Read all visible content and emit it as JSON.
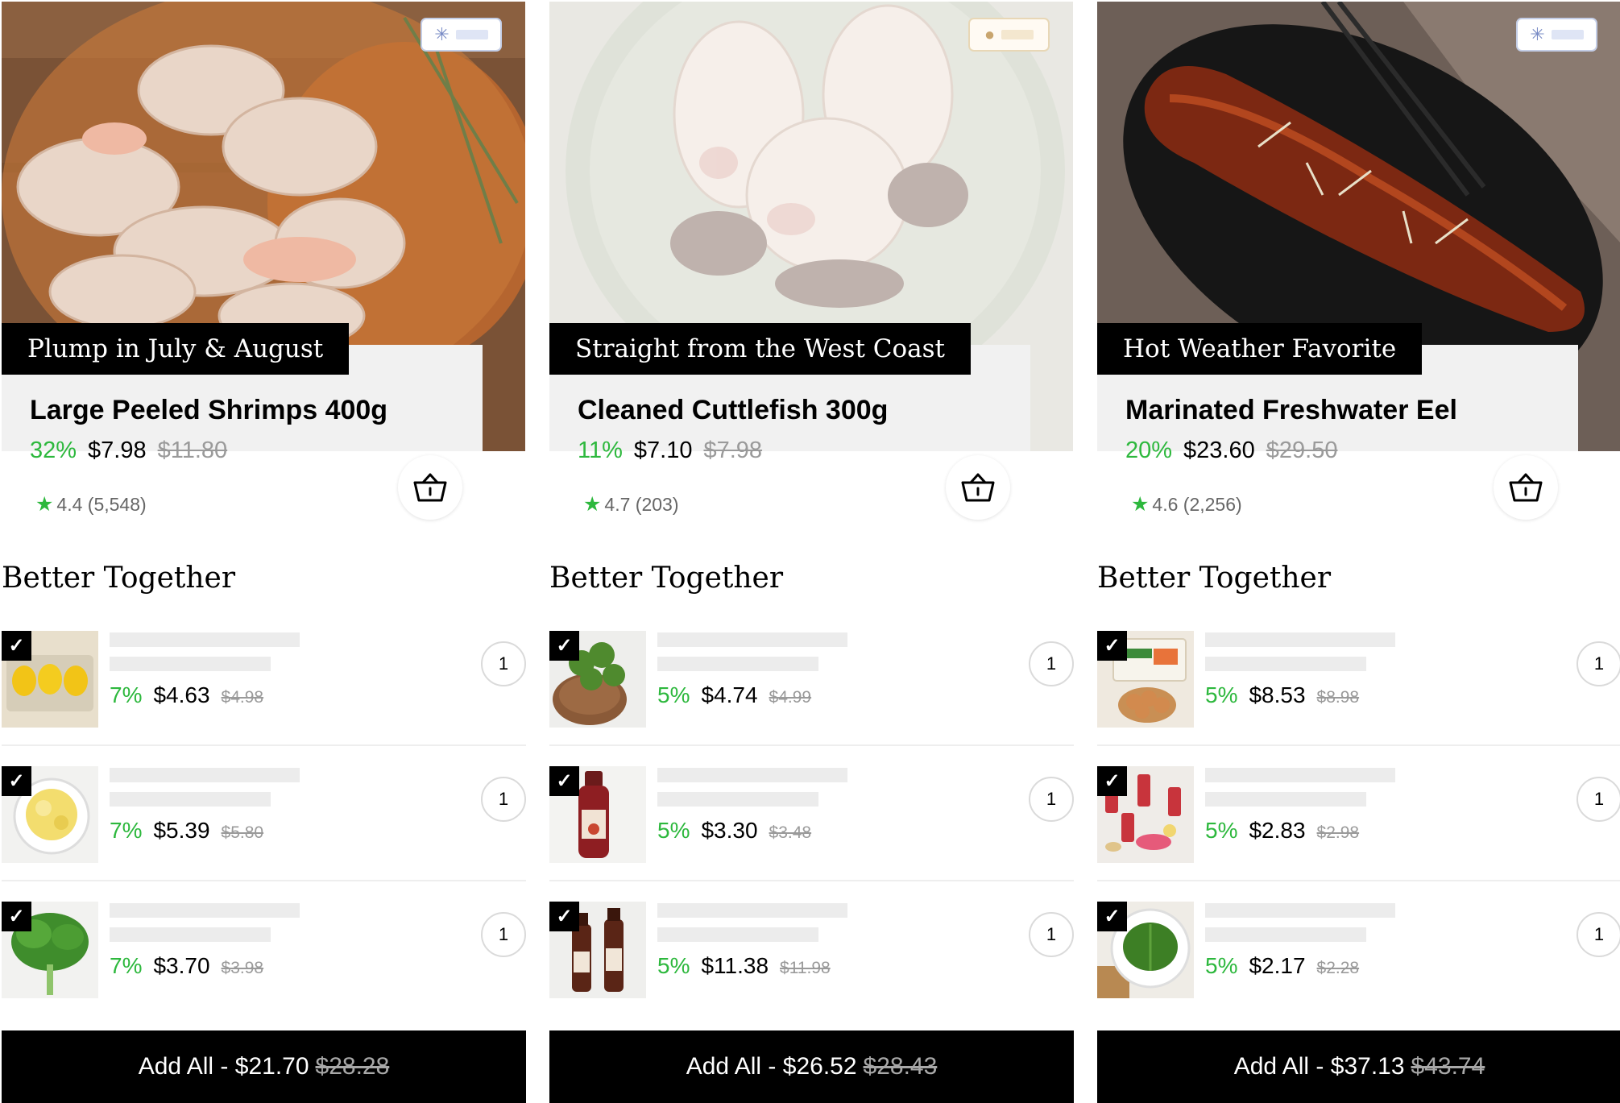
{
  "products": [
    {
      "photo": "shrimp",
      "storage_icon": "snowflake-icon",
      "tag": "Plump in July & August",
      "name": "Large Peeled Shrimps 400g",
      "discount": "32%",
      "price": "$7.98",
      "original_price": "$11.80",
      "rating": "4.4 (5,548)",
      "section_title": "Better Together",
      "bundle": [
        {
          "thumb": "lemons",
          "qty": "1",
          "discount": "7%",
          "price": "$4.63",
          "original_price": "$4.98"
        },
        {
          "thumb": "minced-garlic",
          "qty": "1",
          "discount": "7%",
          "price": "$5.39",
          "original_price": "$5.80"
        },
        {
          "thumb": "cilantro",
          "qty": "1",
          "discount": "7%",
          "price": "$3.70",
          "original_price": "$3.98"
        }
      ],
      "add_all": {
        "label": "Add All - $21.70",
        "original_total": "$28.28"
      }
    },
    {
      "photo": "cuttlefish",
      "storage_icon": "drop-icon",
      "tag": "Straight from the West Coast",
      "name": "Cleaned Cuttlefish 300g",
      "discount": "11%",
      "price": "$7.10",
      "original_price": "$7.98",
      "rating": "4.7 (203)",
      "section_title": "Better Together",
      "bundle": [
        {
          "thumb": "herbs",
          "qty": "1",
          "discount": "5%",
          "price": "$4.74",
          "original_price": "$4.99"
        },
        {
          "thumb": "chili-sauce-bottle",
          "qty": "1",
          "discount": "5%",
          "price": "$3.30",
          "original_price": "$3.48"
        },
        {
          "thumb": "sesame-oil-bottles",
          "qty": "1",
          "discount": "5%",
          "price": "$11.38",
          "original_price": "$11.98"
        }
      ],
      "add_all": {
        "label": "Add All - $26.52",
        "original_total": "$28.43"
      }
    },
    {
      "photo": "eel",
      "storage_icon": "snowflake-icon",
      "tag": "Hot Weather Favorite",
      "name": "Marinated Freshwater Eel",
      "discount": "20%",
      "price": "$23.60",
      "original_price": "$29.50",
      "rating": "4.6 (2,256)",
      "section_title": "Better Together",
      "bundle": [
        {
          "thumb": "eggs",
          "qty": "1",
          "discount": "5%",
          "price": "$8.53",
          "original_price": "$8.98"
        },
        {
          "thumb": "ginger-drinks",
          "qty": "1",
          "discount": "5%",
          "price": "$2.83",
          "original_price": "$2.98"
        },
        {
          "thumb": "perilla-leaves",
          "qty": "1",
          "discount": "5%",
          "price": "$2.17",
          "original_price": "$2.28"
        }
      ],
      "add_all": {
        "label": "Add All - $37.13",
        "original_total": "$43.74"
      }
    }
  ],
  "colors": {
    "discount": "#2db83d",
    "ribbon": "#000000",
    "card_bg": "#f1f1f1"
  }
}
